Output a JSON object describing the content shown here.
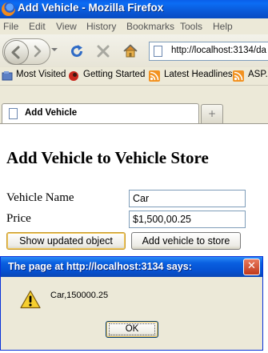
{
  "window": {
    "title": "Add Vehicle - Mozilla Firefox"
  },
  "menu": {
    "items": [
      "File",
      "Edit",
      "View",
      "History",
      "Bookmarks",
      "Tools",
      "Help"
    ]
  },
  "navigation": {
    "back_icon": "back-arrow-icon",
    "forward_icon": "forward-arrow-icon",
    "reload_icon": "reload-icon",
    "stop_icon": "stop-icon",
    "home_icon": "home-icon",
    "url": "http://localhost:3134/da"
  },
  "bookmarks": {
    "items": [
      {
        "label": "Most Visited",
        "icon": "bookmarks-folder-icon"
      },
      {
        "label": "Getting Started",
        "icon": "firefox-getting-started-icon"
      },
      {
        "label": "Latest Headlines",
        "icon": "rss-feed-icon"
      },
      {
        "label": "ASP.",
        "icon": "rss-feed-icon"
      }
    ]
  },
  "tabs": {
    "active": {
      "label": "Add Vehicle"
    },
    "new_tab_icon": "new-tab-icon"
  },
  "page": {
    "heading": "Add Vehicle to Vehicle Store",
    "form": {
      "name_label": "Vehicle Name",
      "name_value": "Car",
      "price_label": "Price",
      "price_value": "$1,500,00.25"
    },
    "buttons": {
      "show_updated": "Show updated object",
      "add_vehicle": "Add vehicle to store"
    }
  },
  "alert": {
    "title": "The page at http://localhost:3134 says:",
    "message": "Car,150000.25",
    "ok_label": "OK",
    "icon": "warning-icon",
    "close_symbol": "✕"
  },
  "colors": {
    "titlebar_blue": "#0a5ee9",
    "dialog_face": "#ece9d8",
    "close_red": "#c0391b"
  }
}
